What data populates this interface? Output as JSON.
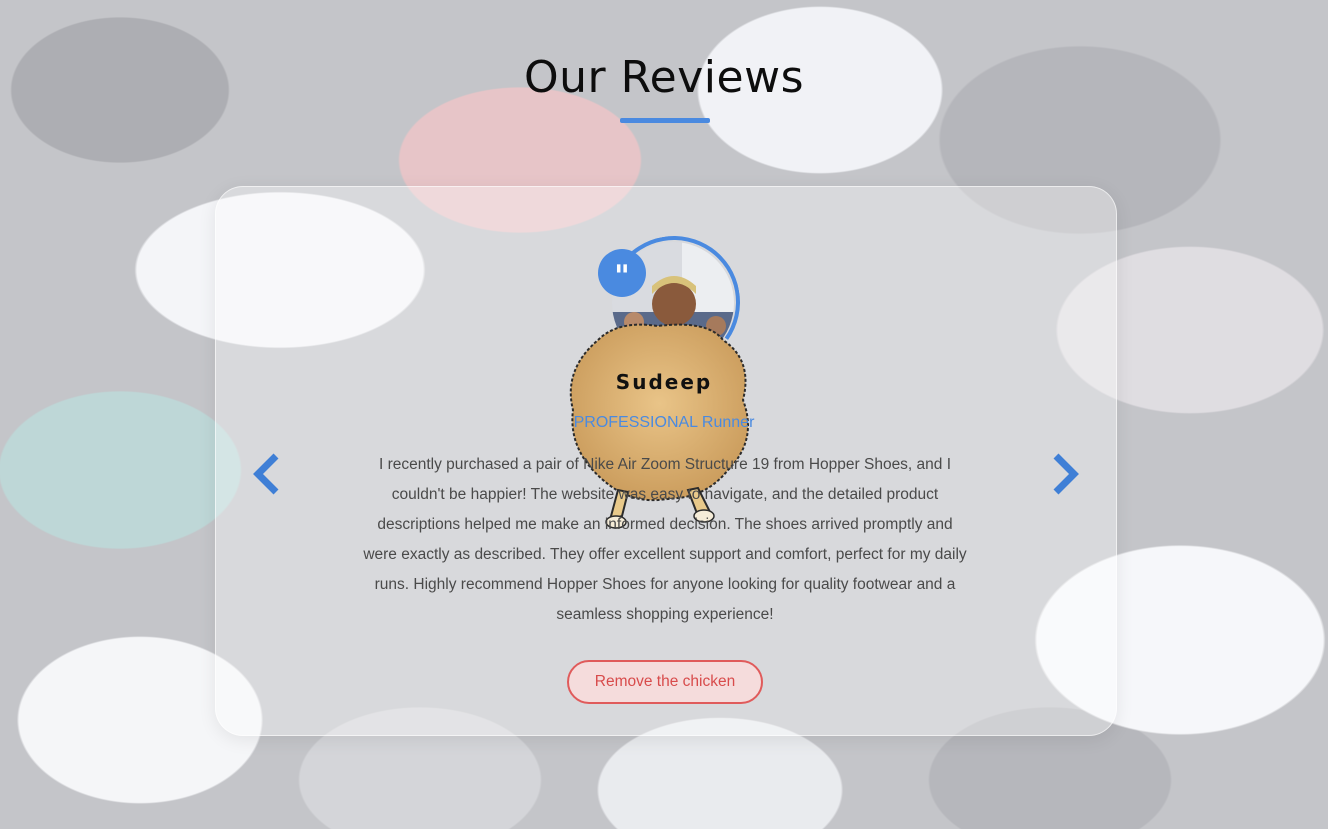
{
  "section": {
    "title": "Our Reviews",
    "accent_color": "#4a8ae0"
  },
  "review": {
    "quote_icon": "quote-icon",
    "quote_glyph": "\"",
    "name": "Sudeep",
    "role": "PROFESSIONAL Runner",
    "text": "I recently purchased a pair of Nike Air Zoom Structure 19 from Hopper Shoes, and I couldn't be happier! The website was easy to navigate, and the detailed product descriptions helped me make an informed decision. The shoes arrived promptly and were exactly as described. They offer excellent support and comfort, perfect for my daily runs. Highly recommend Hopper Shoes for anyone looking for quality footwear and a seamless shopping experience!"
  },
  "actions": {
    "remove_label": "Remove the chicken",
    "prev_icon": "chevron-left-icon",
    "next_icon": "chevron-right-icon"
  }
}
